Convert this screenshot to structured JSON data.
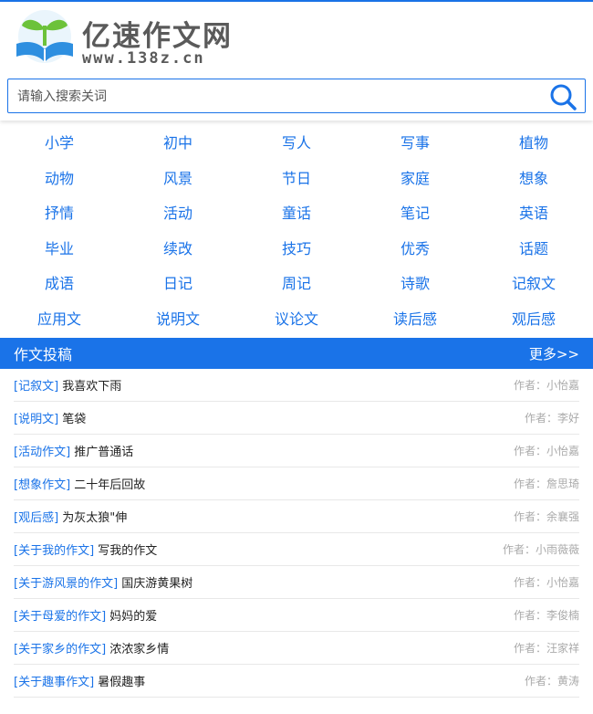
{
  "brand": {
    "name": "亿速作文网",
    "domain": "www.138z.cn"
  },
  "search": {
    "placeholder": "请输入搜索关词"
  },
  "categories": [
    "小学",
    "初中",
    "写人",
    "写事",
    "植物",
    "动物",
    "风景",
    "节日",
    "家庭",
    "想象",
    "抒情",
    "活动",
    "童话",
    "笔记",
    "英语",
    "毕业",
    "续改",
    "技巧",
    "优秀",
    "话题",
    "成语",
    "日记",
    "周记",
    "诗歌",
    "记叙文",
    "应用文",
    "说明文",
    "议论文",
    "读后感",
    "观后感"
  ],
  "section": {
    "title": "作文投稿",
    "more": "更多>>"
  },
  "articles": [
    {
      "cat": "[记叙文]",
      "title": "我喜欢下雨",
      "author": "作者：小怡嘉"
    },
    {
      "cat": "[说明文]",
      "title": "笔袋",
      "author": "作者：李好"
    },
    {
      "cat": "[活动作文]",
      "title": "推广普通话",
      "author": "作者：小怡嘉"
    },
    {
      "cat": "[想象作文]",
      "title": "二十年后回故",
      "author": "作者：詹思琦"
    },
    {
      "cat": "[观后感]",
      "title": "为灰太狼\"伸",
      "author": "作者：余襄强"
    },
    {
      "cat": "[关于我的作文]",
      "title": "写我的作文",
      "author": "作者：小雨薇薇"
    },
    {
      "cat": "[关于游风景的作文]",
      "title": "国庆游黄果树",
      "author": "作者：小怡嘉"
    },
    {
      "cat": "[关于母爱的作文]",
      "title": "妈妈的爱",
      "author": "作者：李俊楠"
    },
    {
      "cat": "[关于家乡的作文]",
      "title": "浓浓家乡情",
      "author": "作者：汪家祥"
    },
    {
      "cat": "[关于趣事作文]",
      "title": "暑假趣事",
      "author": "作者：黄涛"
    }
  ],
  "colors": {
    "accent": "#1a73e8",
    "logo_green": "#6cc23a",
    "logo_blue": "#2e8fe0"
  },
  "icons": {
    "logo": "sprout-book-logo",
    "search": "search-icon"
  }
}
